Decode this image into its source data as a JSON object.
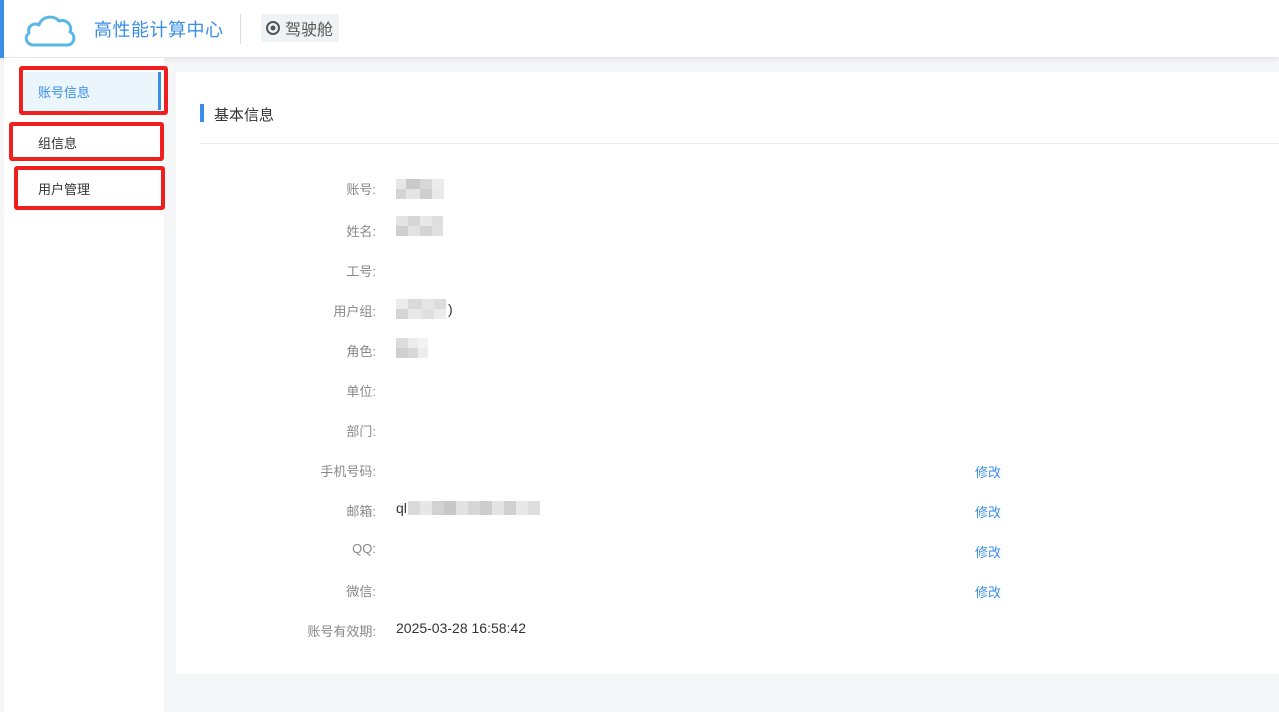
{
  "header": {
    "app_title": "高性能计算中心",
    "cockpit_label": "驾驶舱",
    "logo_icon": "cloud-icon",
    "cockpit_icon": "dashboard-icon"
  },
  "sidebar": {
    "items": [
      {
        "label": "账号信息",
        "active": true
      },
      {
        "label": "组信息",
        "active": false
      },
      {
        "label": "用户管理",
        "active": false
      }
    ]
  },
  "section": {
    "title": "基本信息"
  },
  "fields": {
    "account": {
      "label": "账号:",
      "value": ""
    },
    "name": {
      "label": "姓名:",
      "value": ""
    },
    "employee_id": {
      "label": "工号:",
      "value": ""
    },
    "user_group": {
      "label": "用户组:",
      "value_suffix": ")"
    },
    "role": {
      "label": "角色:",
      "value": ""
    },
    "organization": {
      "label": "单位:",
      "value": ""
    },
    "department": {
      "label": "部门:",
      "value": ""
    },
    "phone": {
      "label": "手机号码:",
      "value": "",
      "edit_label": "修改"
    },
    "email": {
      "label": "邮箱:",
      "value_prefix": "ql",
      "edit_label": "修改"
    },
    "qq": {
      "label": "QQ:",
      "value": "",
      "edit_label": "修改"
    },
    "wechat": {
      "label": "微信:",
      "value": "",
      "edit_label": "修改"
    },
    "expiry": {
      "label": "账号有效期:",
      "value": "2025-03-28 16:58:42"
    }
  },
  "colors": {
    "accent": "#3a8ee6",
    "highlight_border": "#f01f1f",
    "active_bg": "#eaf5fc"
  }
}
